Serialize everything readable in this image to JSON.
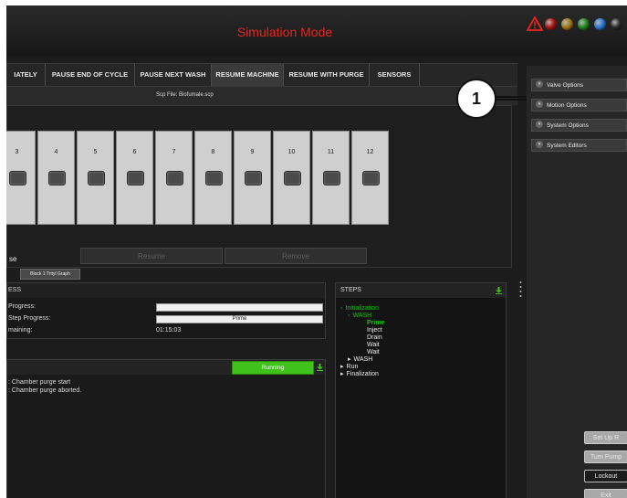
{
  "header": {
    "title": "Simulation Mode",
    "accent_color": "#e8271f",
    "indicator_colors": [
      "#b11414",
      "#a27a12",
      "#1f8a1f",
      "#2a78d6",
      "#2b2b2b"
    ]
  },
  "toolbar": {
    "items": [
      "IATELY",
      "PAUSE END OF CYCLE",
      "PAUSE NEXT WASH",
      "RESUME MACHINE",
      "RESUME WITH PURGE",
      "SENSORS"
    ],
    "selected": "RESUME MACHINE"
  },
  "scp_file": "Scp File:  Biofumale.scp",
  "pumps": [
    "3",
    "4",
    "5",
    "6",
    "7",
    "8",
    "9",
    "10",
    "11",
    "12"
  ],
  "pump_actions": {
    "partial_label": "se",
    "resume": "Resume",
    "remove": "Remove"
  },
  "block_tab": "Block 1:Trityl Graph",
  "progress": {
    "header": "ESS",
    "rows": [
      {
        "label": "Progress:",
        "value": ""
      },
      {
        "label": "Step Progress:",
        "value": "Prime"
      },
      {
        "label": "maining:",
        "value": "01:15:03"
      }
    ]
  },
  "log": {
    "status": "Running",
    "status_color": "#3fc21a",
    "lines": [
      ": Chamber purge start",
      ": Chamber purge aborted."
    ]
  },
  "steps": {
    "header": "STEPS",
    "items": [
      {
        "label": "Initialization",
        "marker": "◦",
        "level": 0,
        "state": "active"
      },
      {
        "label": "WASH",
        "marker": "◦",
        "level": 1,
        "state": "active"
      },
      {
        "label": "Prime",
        "marker": "",
        "level": 2,
        "state": "current"
      },
      {
        "label": "Inject",
        "marker": "",
        "level": 2,
        "state": "normal"
      },
      {
        "label": "Drain",
        "marker": "",
        "level": 2,
        "state": "normal"
      },
      {
        "label": "Wait",
        "marker": "",
        "level": 2,
        "state": "normal"
      },
      {
        "label": "Wait",
        "marker": "",
        "level": 2,
        "state": "normal"
      },
      {
        "label": "WASH",
        "marker": "▸",
        "level": 1,
        "state": "normal"
      },
      {
        "label": "Run",
        "marker": "▸",
        "level": 0,
        "state": "normal"
      },
      {
        "label": "Finalization",
        "marker": "▸",
        "level": 0,
        "state": "normal"
      }
    ]
  },
  "options": [
    "Valve Options",
    "Motion Options",
    "System Options",
    "System Editors"
  ],
  "side_buttons": [
    "Set Up R",
    "Turn Pump",
    "Lockout",
    "Exit"
  ],
  "callout_number": "1",
  "icons": {
    "warning": "warning-triangle-icon",
    "download": "download-arrow-icon",
    "option_arrow": "chevron-circle-icon"
  }
}
